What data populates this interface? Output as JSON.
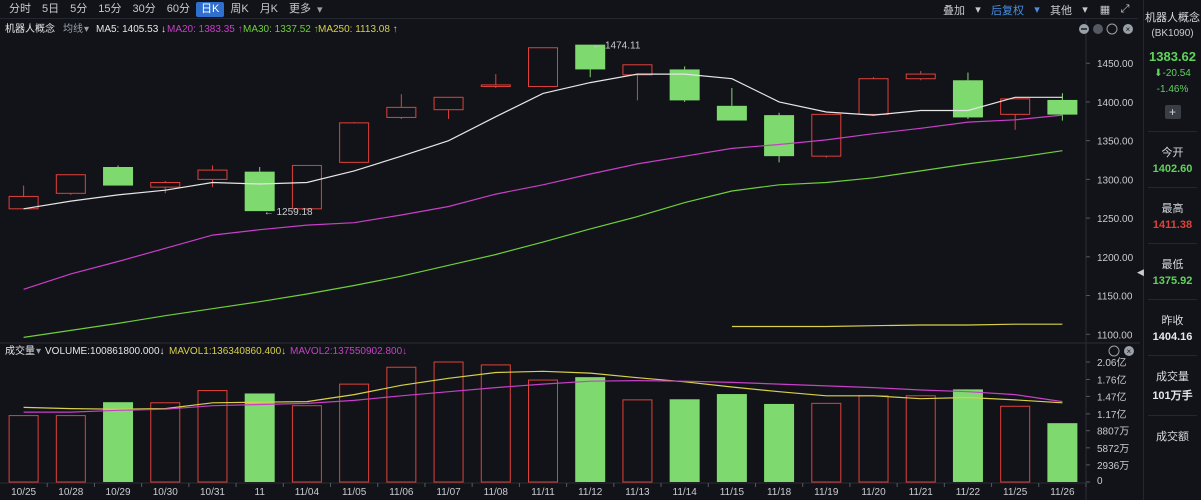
{
  "toolbar": {
    "periods": [
      "分时",
      "5日",
      "5分",
      "15分",
      "30分",
      "60分",
      "日K",
      "周K",
      "月K",
      "更多"
    ],
    "active_period": "日K",
    "overlay": "叠加",
    "adjust": "后复权",
    "other": "其他"
  },
  "main_legend": {
    "name": "机器人概念",
    "ma_type": "均线",
    "ma5": "MA5: 1405.53 ↓",
    "ma20": "MA20: 1383.35 ↑",
    "ma30": "MA30: 1337.52 ↑",
    "ma250": "MA250: 1113.08 ↑"
  },
  "vol_legend": {
    "name": "成交量",
    "volume": "VOLUME:100861800.000↓",
    "mavol1": "MAVOL1:136340860.400↓",
    "mavol2": "MAVOL2:137550902.800↓"
  },
  "sidebar": {
    "name": "机器人概念",
    "code": "(BK1090)",
    "price": "1383.62",
    "change": "-20.54",
    "change_pct": "-1.46%",
    "open_label": "今开",
    "open": "1402.60",
    "high_label": "最高",
    "high": "1411.38",
    "low_label": "最低",
    "low": "1375.92",
    "prev_close_label": "昨收",
    "prev_close": "1404.16",
    "volume_label": "成交量",
    "volume": "101万手",
    "turnover_label": "成交额"
  },
  "colors": {
    "up": "#e0413a",
    "down": "#7ed96e",
    "ma5": "#e6e6e6",
    "ma20": "#c93fc8",
    "ma30": "#6fcf3a",
    "ma250": "#d8d04a",
    "mavol1": "#d8d04a",
    "mavol2": "#c93fc8"
  },
  "chart_data": {
    "type": "candlestick",
    "dates": [
      "10/25",
      "10/28",
      "10/29",
      "10/30",
      "10/31",
      "11",
      "11/04",
      "11/05",
      "11/06",
      "11/07",
      "11/08",
      "11/11",
      "11/12",
      "11/13",
      "11/14",
      "11/15",
      "11/18",
      "11/19",
      "11/20",
      "11/21",
      "11/22",
      "11/25",
      "11/26"
    ],
    "ohlc": [
      [
        1262,
        1278,
        1262,
        1292
      ],
      [
        1282,
        1306,
        1280,
        1306
      ],
      [
        1316,
        1292,
        1292,
        1318
      ],
      [
        1290,
        1296,
        1282,
        1298
      ],
      [
        1300,
        1312,
        1290,
        1318
      ],
      [
        1310,
        1259,
        1259,
        1316
      ],
      [
        1262,
        1318,
        1260,
        1318
      ],
      [
        1322,
        1373,
        1322,
        1374
      ],
      [
        1380,
        1393,
        1378,
        1410
      ],
      [
        1390,
        1406,
        1378,
        1406
      ],
      [
        1420,
        1422,
        1418,
        1436
      ],
      [
        1420,
        1470,
        1420,
        1470
      ],
      [
        1474,
        1442,
        1432,
        1474
      ],
      [
        1435,
        1448,
        1402,
        1448
      ],
      [
        1442,
        1402,
        1400,
        1446
      ],
      [
        1395,
        1376,
        1376,
        1418
      ],
      [
        1383,
        1330,
        1322,
        1386
      ],
      [
        1330,
        1384,
        1328,
        1384
      ],
      [
        1384,
        1430,
        1382,
        1432
      ],
      [
        1430,
        1436,
        1428,
        1440
      ],
      [
        1428,
        1380,
        1378,
        1438
      ],
      [
        1384,
        1404,
        1364,
        1404
      ],
      [
        1402.6,
        1383.62,
        1375.92,
        1411.38
      ]
    ],
    "ma5": [
      1262,
      1272,
      1280,
      1286,
      1296,
      1294,
      1296,
      1311,
      1330,
      1350,
      1381,
      1411,
      1425,
      1436,
      1436,
      1430,
      1400,
      1387,
      1383,
      1389,
      1389,
      1406,
      1406
    ],
    "ma20": [
      1158,
      1178,
      1194,
      1211,
      1228,
      1235,
      1241,
      1244,
      1254,
      1265,
      1281,
      1293,
      1307,
      1320,
      1330,
      1340,
      1345,
      1351,
      1359,
      1366,
      1374,
      1377,
      1383
    ],
    "ma30": [
      1096,
      1105,
      1114,
      1124,
      1133,
      1142,
      1152,
      1163,
      1175,
      1189,
      1203,
      1219,
      1236,
      1252,
      1270,
      1285,
      1293,
      1296,
      1302,
      1311,
      1320,
      1328,
      1337
    ],
    "ma250": [
      null,
      null,
      null,
      null,
      null,
      null,
      null,
      null,
      null,
      null,
      null,
      null,
      null,
      null,
      null,
      1110,
      1110,
      1110,
      1111,
      1112,
      1112,
      1113,
      1113
    ],
    "price_axis": {
      "min": 1090,
      "max": 1480,
      "ticks": [
        "1450.00",
        "1400.00",
        "1350.00",
        "1300.00",
        "1250.00",
        "1200.00",
        "1150.00",
        "1100.00"
      ]
    },
    "hi_label": "1474.11",
    "lo_label": "1259.18",
    "volume": [
      1.14,
      1.14,
      1.37,
      1.36,
      1.57,
      1.52,
      1.31,
      1.68,
      1.97,
      2.06,
      2.01,
      1.75,
      1.8,
      1.41,
      1.42,
      1.51,
      1.34,
      1.35,
      1.48,
      1.48,
      1.59,
      1.3,
      1.01
    ],
    "mavol1": [
      1.28,
      1.26,
      1.25,
      1.26,
      1.36,
      1.37,
      1.38,
      1.5,
      1.66,
      1.78,
      1.88,
      1.9,
      1.87,
      1.79,
      1.72,
      1.63,
      1.55,
      1.48,
      1.48,
      1.43,
      1.45,
      1.41,
      1.36
    ],
    "mavol2": [
      1.2,
      1.2,
      1.23,
      1.25,
      1.31,
      1.33,
      1.35,
      1.4,
      1.48,
      1.55,
      1.62,
      1.68,
      1.73,
      1.74,
      1.73,
      1.71,
      1.68,
      1.65,
      1.62,
      1.58,
      1.55,
      1.5,
      1.38
    ],
    "volume_axis": {
      "min": 0,
      "max": 2.06,
      "ticks": [
        {
          "label": "2.06亿",
          "v": 2.06
        },
        {
          "label": "1.76亿",
          "v": 1.76
        },
        {
          "label": "1.47亿",
          "v": 1.47
        },
        {
          "label": "1.17亿",
          "v": 1.17
        },
        {
          "label": "8807万",
          "v": 0.8807
        },
        {
          "label": "5872万",
          "v": 0.5872
        },
        {
          "label": "2936万",
          "v": 0.2936
        },
        {
          "label": "0",
          "v": 0
        }
      ]
    }
  }
}
